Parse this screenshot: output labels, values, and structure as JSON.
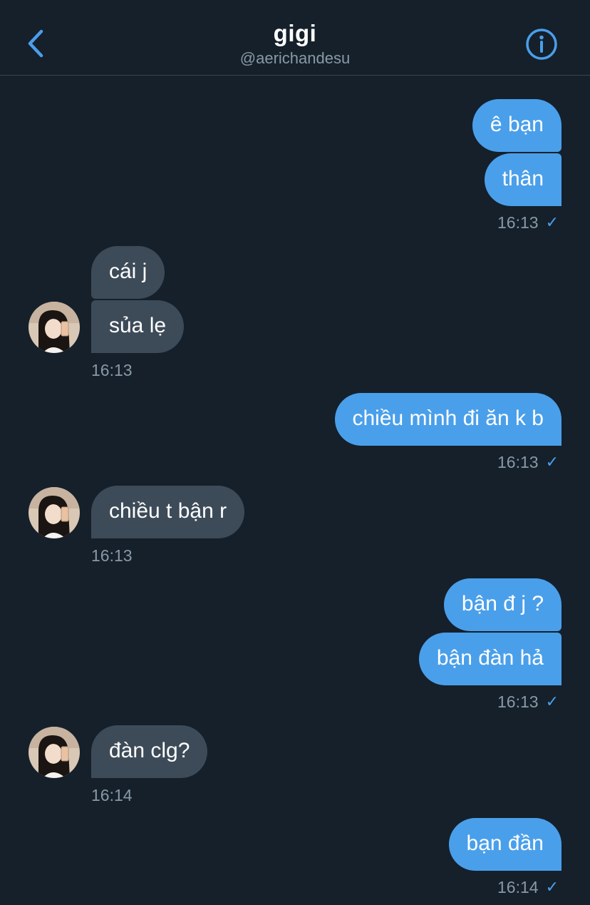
{
  "header": {
    "title": "gigi",
    "handle": "@aerichandesu",
    "back_icon": "chevron-left-icon",
    "info_icon": "info-icon"
  },
  "colors": {
    "background": "#15202b",
    "sent_bubble": "#4a9fea",
    "received_bubble": "#3d4b59",
    "accent": "#4a9fea",
    "muted_text": "#8899a6"
  },
  "messages": [
    {
      "sender": "me",
      "text": "ê bạn"
    },
    {
      "sender": "me",
      "text": "thân",
      "time": "16:13",
      "status": "✓"
    },
    {
      "sender": "gigi",
      "text": "cái j"
    },
    {
      "sender": "gigi",
      "text": "sủa lẹ",
      "time": "16:13"
    },
    {
      "sender": "me",
      "text": "chiều mình đi ăn k b",
      "time": "16:13",
      "status": "✓"
    },
    {
      "sender": "gigi",
      "text": "chiều t bận r",
      "time": "16:13"
    },
    {
      "sender": "me",
      "text": "bận đ j ?"
    },
    {
      "sender": "me",
      "text": "bận đàn hả",
      "time": "16:13",
      "status": "✓"
    },
    {
      "sender": "gigi",
      "text": "đàn clg?",
      "time": "16:14"
    },
    {
      "sender": "me",
      "text": "bạn đần",
      "time": "16:14",
      "status": "✓"
    }
  ]
}
